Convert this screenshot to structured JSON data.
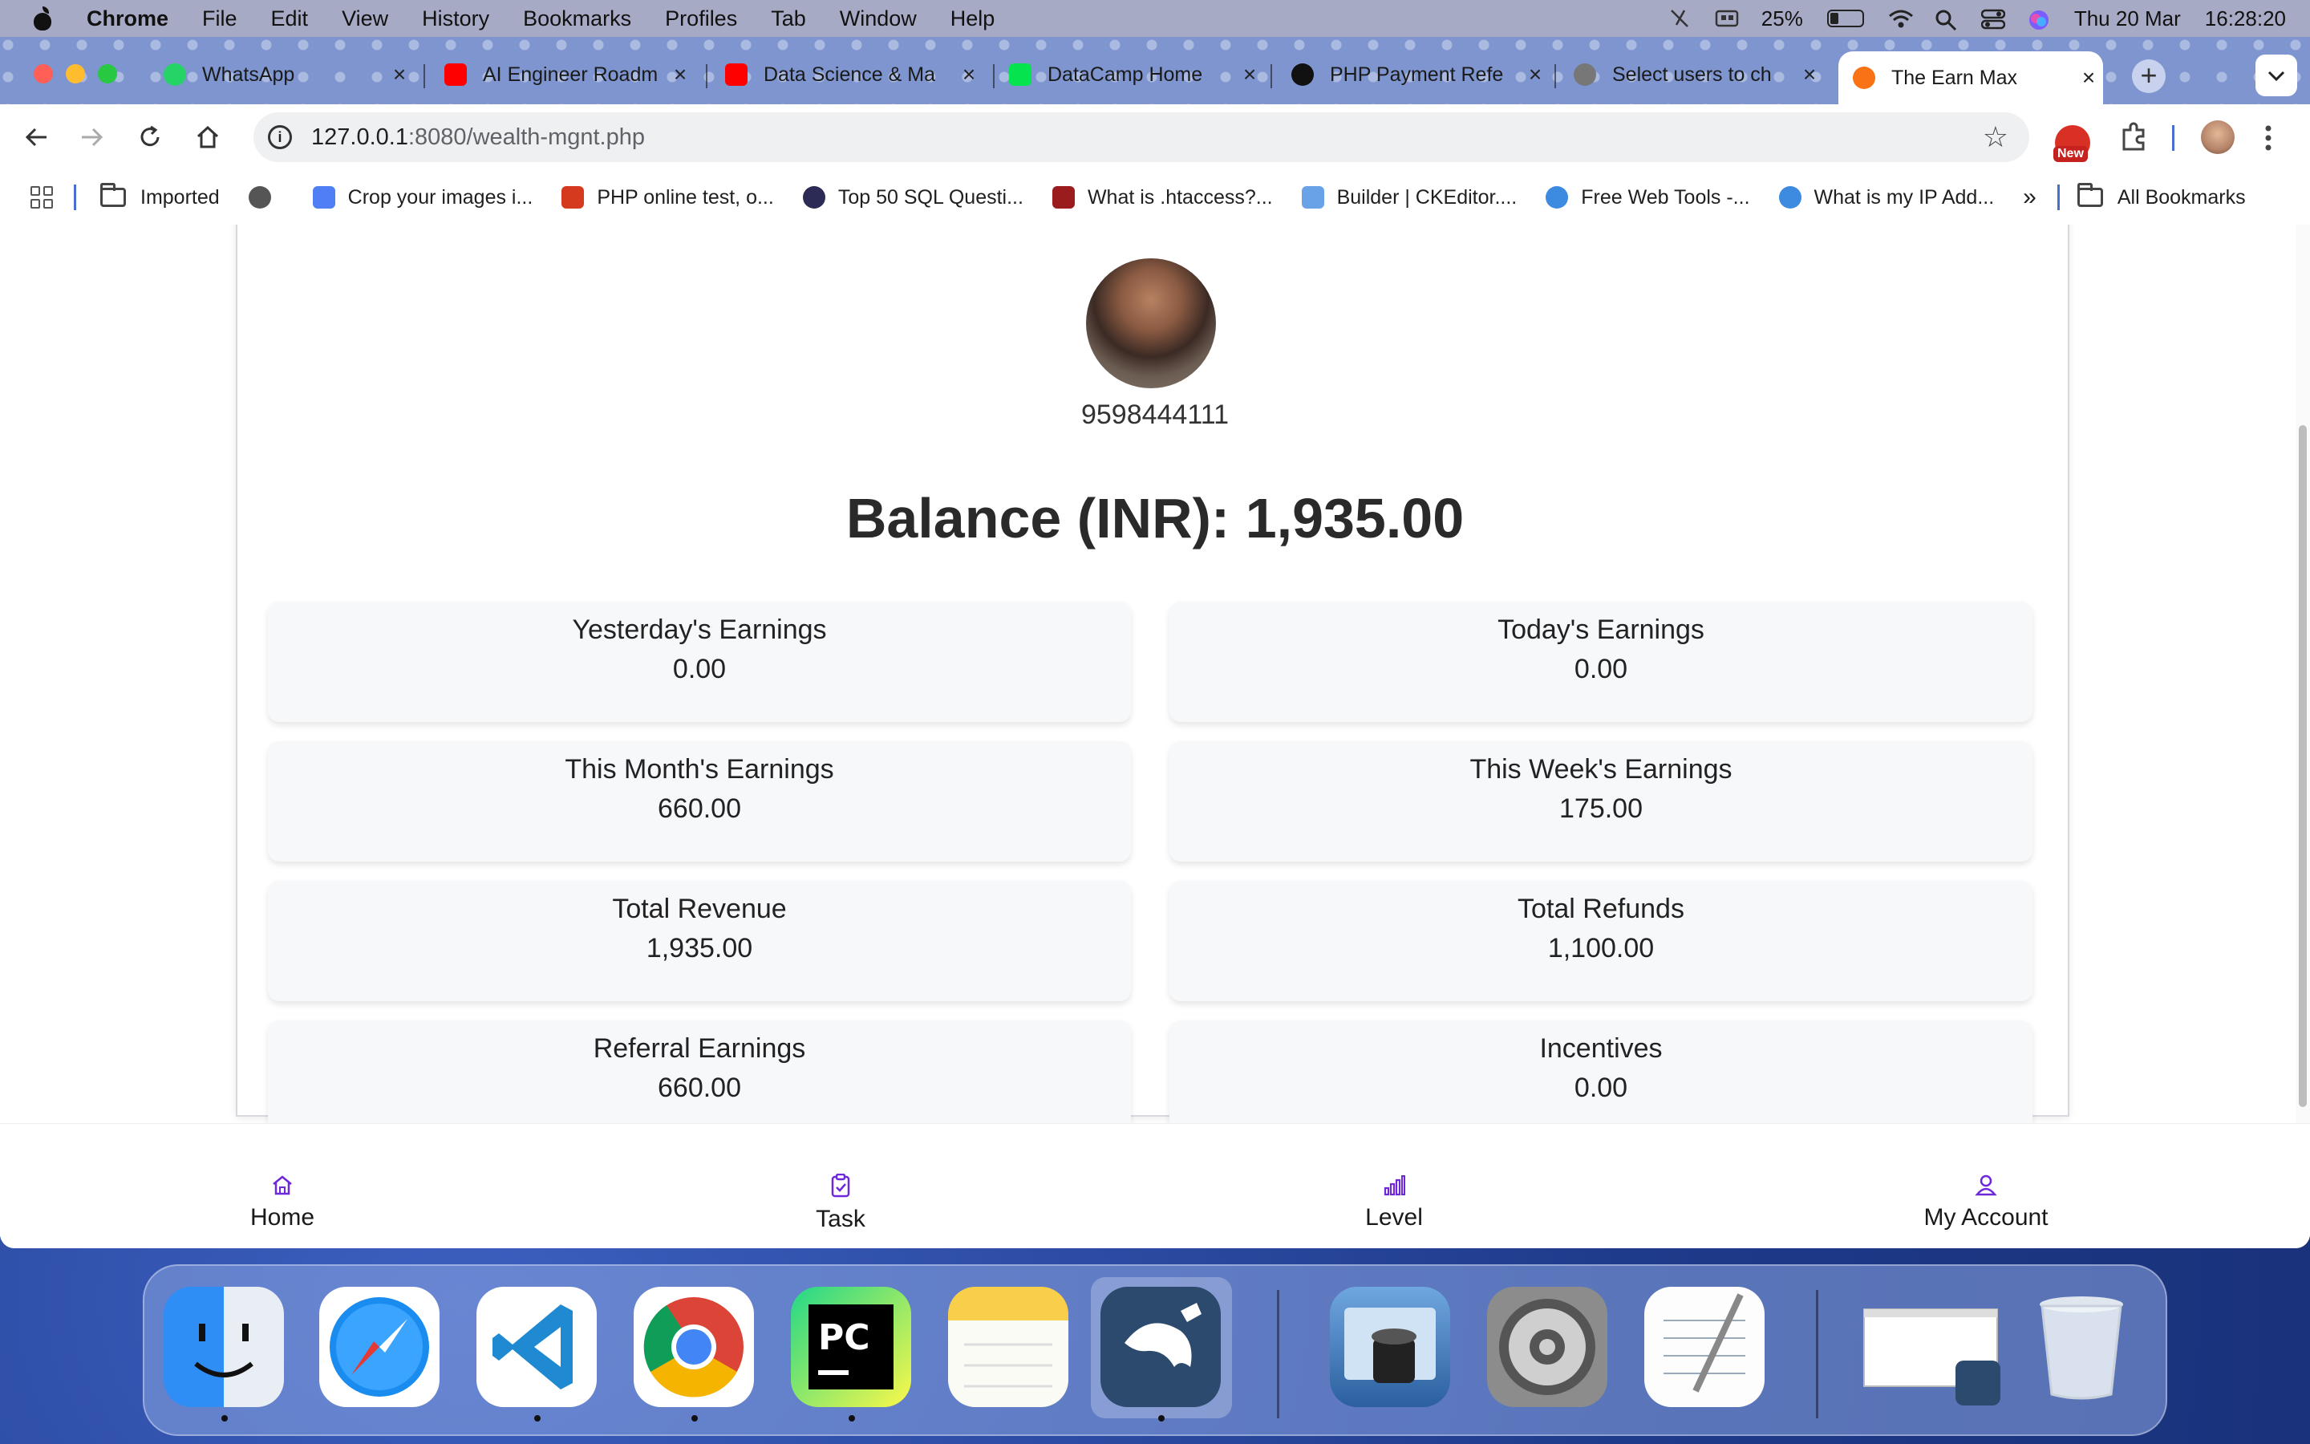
{
  "menubar": {
    "app": "Chrome",
    "items": [
      "File",
      "Edit",
      "View",
      "History",
      "Bookmarks",
      "Profiles",
      "Tab",
      "Window",
      "Help"
    ],
    "battery_percent": "25%",
    "battery_level": 0.25,
    "date": "Thu 20 Mar",
    "time": "16:28:20"
  },
  "tabs": [
    {
      "title": "WhatsApp",
      "favicon_color": "#25d366"
    },
    {
      "title": "AI Engineer Roadm",
      "favicon_color": "#ff0000"
    },
    {
      "title": "Data Science & Ma",
      "favicon_color": "#ff0000"
    },
    {
      "title": "DataCamp Home",
      "favicon_color": "#05e34f"
    },
    {
      "title": "PHP Payment Refe",
      "favicon_color": "#111111"
    },
    {
      "title": "Select users to ch",
      "favicon_color": "#777777"
    },
    {
      "title": "The Earn Max",
      "favicon_color": "#f97316",
      "active": true
    }
  ],
  "toolbar": {
    "url_host": "127.0.0.1",
    "url_path": ":8080/wealth-mgnt.php",
    "new_badge": "New"
  },
  "bookmarks": [
    {
      "label": "Imported",
      "type": "folder"
    },
    {
      "label": "",
      "type": "globe"
    },
    {
      "label": "Crop your images i...",
      "color": "#4f7ef5"
    },
    {
      "label": "PHP online test, o...",
      "color": "#d63a1e"
    },
    {
      "label": "Top 50 SQL Questi...",
      "color": "#2b2b55"
    },
    {
      "label": "What is .htaccess?...",
      "color": "#9b1c1c"
    },
    {
      "label": "Builder | CKEditor....",
      "color": "#6aa2e8"
    },
    {
      "label": "Free Web Tools -...",
      "color": "#3d8be0"
    },
    {
      "label": "What is my IP Add...",
      "color": "#3d8be0"
    }
  ],
  "bookmarks_overflow": "»",
  "all_bookmarks": "All Bookmarks",
  "profile": {
    "phone": "9598444111"
  },
  "balance_text": "Balance (INR): 1,935.00",
  "stats": [
    {
      "label": "Yesterday's Earnings",
      "value": "0.00"
    },
    {
      "label": "Today's Earnings",
      "value": "0.00"
    },
    {
      "label": "This Month's Earnings",
      "value": "660.00"
    },
    {
      "label": "This Week's Earnings",
      "value": "175.00"
    },
    {
      "label": "Total Revenue",
      "value": "1,935.00"
    },
    {
      "label": "Total Refunds",
      "value": "1,100.00"
    },
    {
      "label": "Referral Earnings",
      "value": "660.00"
    },
    {
      "label": "Incentives",
      "value": "0.00"
    }
  ],
  "bottom_nav": [
    {
      "label": "Home",
      "icon": "home-icon"
    },
    {
      "label": "Task",
      "icon": "clipboard-icon"
    },
    {
      "label": "Level",
      "icon": "bar-chart-icon"
    },
    {
      "label": "My Account",
      "icon": "user-icon"
    }
  ],
  "accent_color": "#6d28d9",
  "dock": {
    "apps": [
      "Finder",
      "Safari",
      "Visual Studio Code",
      "Google Chrome",
      "PyCharm",
      "Notes",
      "MySQL Workbench",
      "Preview",
      "System Settings",
      "TextEdit",
      "Recent Window",
      "Trash"
    ]
  }
}
